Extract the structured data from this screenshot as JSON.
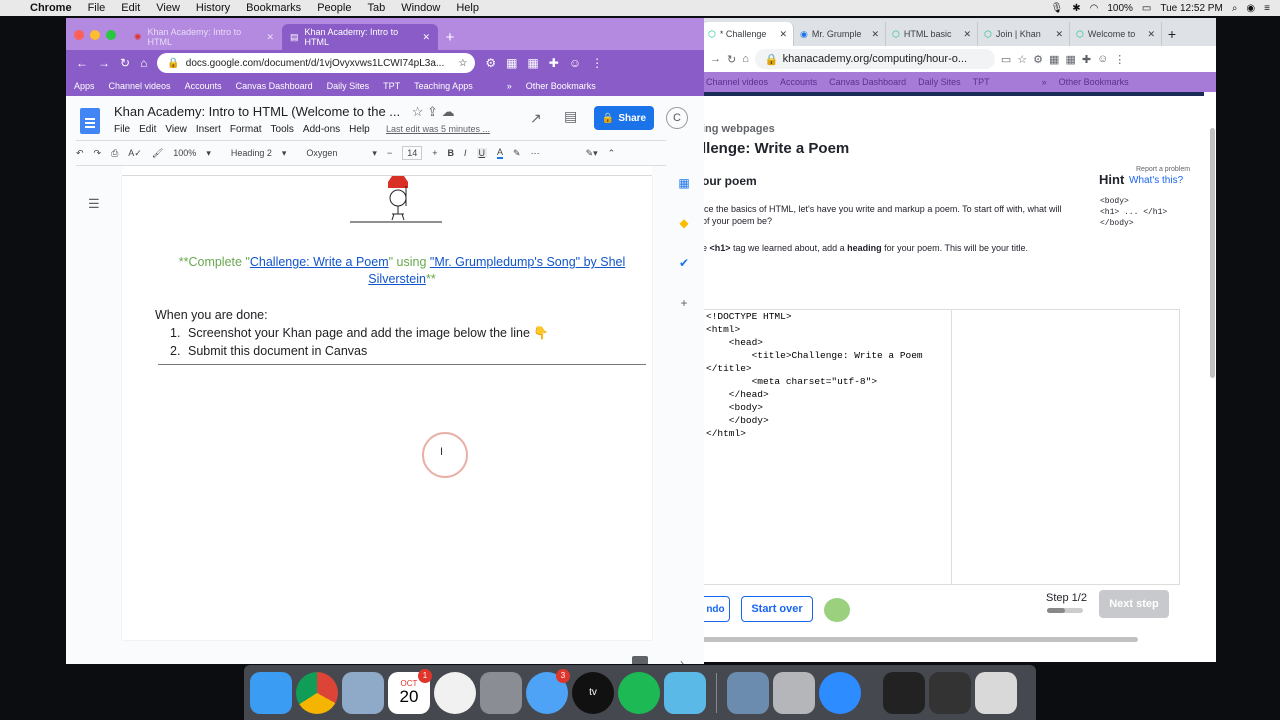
{
  "menubar": {
    "app": "Chrome",
    "items": [
      "File",
      "Edit",
      "View",
      "History",
      "Bookmarks",
      "People",
      "Tab",
      "Window",
      "Help"
    ],
    "battery": "100%",
    "clock": "Tue 12:52 PM"
  },
  "left_window": {
    "tabs": [
      {
        "title": "Khan Academy: Intro to HTML"
      },
      {
        "title": "Khan Academy: Intro to HTML"
      }
    ],
    "url": "docs.google.com/document/d/1vjOvyxvws1LCWI74pL3a...",
    "bookmarks": [
      "Apps",
      "Channel videos",
      "Accounts",
      "Canvas Dashboard",
      "Daily Sites",
      "TPT",
      "Teaching Apps",
      "»",
      "Other Bookmarks"
    ],
    "doc": {
      "title": "Khan Academy: Intro to HTML (Welcome to the ...",
      "menu": [
        "File",
        "Edit",
        "View",
        "Insert",
        "Format",
        "Tools",
        "Add-ons",
        "Help"
      ],
      "last_edit": "Last edit was 5 minutes ...",
      "share": "Share",
      "user_initial": "C",
      "toolbar": {
        "zoom": "100%",
        "style": "Heading 2",
        "font": "Oxygen",
        "size": "14"
      },
      "line1_pre": "**Complete \"",
      "line1_link": "Challenge: Write a Poem",
      "line1_mid": "\" using ",
      "line1_link2": "\"Mr. Grumpledump's Song\" by Shel Silverstein",
      "line1_post": "**",
      "done_heading": "When you are done:",
      "list": [
        {
          "num": "1.",
          "text": "Screenshot your Khan page and add the image below the line 👇"
        },
        {
          "num": "2.",
          "text": "Submit this document in Canvas"
        }
      ]
    }
  },
  "right_window": {
    "tabs": [
      {
        "title": "* Challenge"
      },
      {
        "title": "Mr. Grumple"
      },
      {
        "title": "HTML basic"
      },
      {
        "title": "Join | Khan"
      },
      {
        "title": "Welcome to"
      }
    ],
    "url": "khanacademy.org/computing/hour-o...",
    "bookmarks": [
      "Channel videos",
      "Accounts",
      "Canvas Dashboard",
      "Daily Sites",
      "TPT",
      "»",
      "Other Bookmarks"
    ],
    "khan": {
      "section": "ing webpages",
      "title": "llenge: Write a Poem",
      "report": "Report a problem",
      "subheading": "our poem",
      "hint": "Hint",
      "whats_this": "What's this?",
      "hint_code": "<body>\n<h1> ... </h1>\n</body>",
      "para1": "ice the basics of HTML, let's have you write and markup a poem. To start off with, what will\nof your poem be?",
      "para2_a": "e ",
      "para2_tag": "<h1>",
      "para2_b": " tag we learned about, add a ",
      "para2_bold": "heading",
      "para2_c": " for your poem. This will be your title.",
      "code": "<!DOCTYPE HTML>\n<html>\n    <head>\n        <title>Challenge: Write a Poem\n</title>\n        <meta charset=\"utf-8\">\n    </head>\n    <body>\n    </body>\n</html>",
      "undo": "ndo",
      "start_over": "Start over",
      "step": "Step 1/2",
      "step_progress": 0.5,
      "next_step": "Next step"
    }
  },
  "dock": {
    "calendar_month": "OCT",
    "calendar_day": "20",
    "calendar_badge": "1",
    "messages_badge": "3"
  }
}
